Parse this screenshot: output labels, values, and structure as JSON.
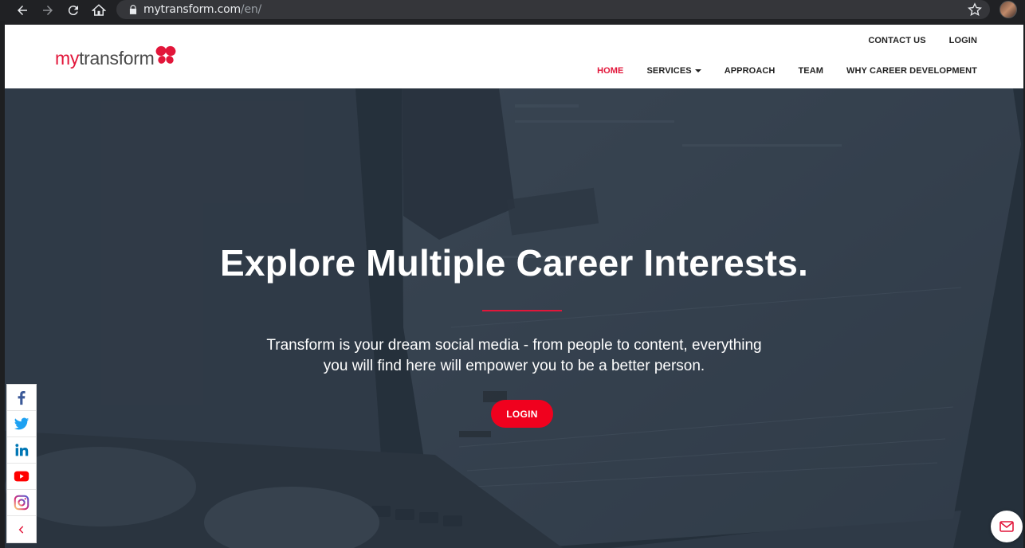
{
  "browser": {
    "url_host": "mytransform.com",
    "url_path": "/en/"
  },
  "header": {
    "logo_my": "my",
    "logo_rest": "transform",
    "top_links": [
      "CONTACT US",
      "LOGIN"
    ],
    "main_links": {
      "home": "HOME",
      "services": "SERVICES",
      "approach": "APPROACH",
      "team": "TEAM",
      "why": "WHY CAREER DEVELOPMENT"
    },
    "active": "HOME"
  },
  "hero": {
    "title": "Explore Multiple Career Interests.",
    "subtitle_line1": "Transform is your dream social media - from people to content, everything",
    "subtitle_line2": "you will find here will empower you to be a better person.",
    "button": "LOGIN"
  },
  "social": [
    "facebook-icon",
    "twitter-icon",
    "linkedin-icon",
    "youtube-icon",
    "instagram-icon",
    "chevron-left-icon"
  ],
  "colors": {
    "brand": "#e2163a",
    "button": "#f0011e"
  }
}
